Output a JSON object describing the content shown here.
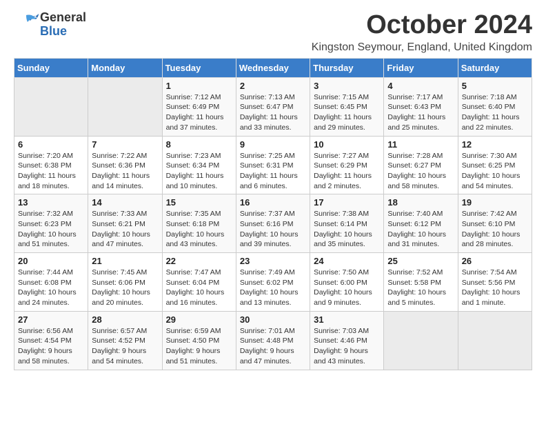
{
  "logo": {
    "general": "General",
    "blue": "Blue"
  },
  "title": "October 2024",
  "subtitle": "Kingston Seymour, England, United Kingdom",
  "days_of_week": [
    "Sunday",
    "Monday",
    "Tuesday",
    "Wednesday",
    "Thursday",
    "Friday",
    "Saturday"
  ],
  "weeks": [
    [
      {
        "day": "",
        "info": ""
      },
      {
        "day": "",
        "info": ""
      },
      {
        "day": "1",
        "info": "Sunrise: 7:12 AM\nSunset: 6:49 PM\nDaylight: 11 hours and 37 minutes."
      },
      {
        "day": "2",
        "info": "Sunrise: 7:13 AM\nSunset: 6:47 PM\nDaylight: 11 hours and 33 minutes."
      },
      {
        "day": "3",
        "info": "Sunrise: 7:15 AM\nSunset: 6:45 PM\nDaylight: 11 hours and 29 minutes."
      },
      {
        "day": "4",
        "info": "Sunrise: 7:17 AM\nSunset: 6:43 PM\nDaylight: 11 hours and 25 minutes."
      },
      {
        "day": "5",
        "info": "Sunrise: 7:18 AM\nSunset: 6:40 PM\nDaylight: 11 hours and 22 minutes."
      }
    ],
    [
      {
        "day": "6",
        "info": "Sunrise: 7:20 AM\nSunset: 6:38 PM\nDaylight: 11 hours and 18 minutes."
      },
      {
        "day": "7",
        "info": "Sunrise: 7:22 AM\nSunset: 6:36 PM\nDaylight: 11 hours and 14 minutes."
      },
      {
        "day": "8",
        "info": "Sunrise: 7:23 AM\nSunset: 6:34 PM\nDaylight: 11 hours and 10 minutes."
      },
      {
        "day": "9",
        "info": "Sunrise: 7:25 AM\nSunset: 6:31 PM\nDaylight: 11 hours and 6 minutes."
      },
      {
        "day": "10",
        "info": "Sunrise: 7:27 AM\nSunset: 6:29 PM\nDaylight: 11 hours and 2 minutes."
      },
      {
        "day": "11",
        "info": "Sunrise: 7:28 AM\nSunset: 6:27 PM\nDaylight: 10 hours and 58 minutes."
      },
      {
        "day": "12",
        "info": "Sunrise: 7:30 AM\nSunset: 6:25 PM\nDaylight: 10 hours and 54 minutes."
      }
    ],
    [
      {
        "day": "13",
        "info": "Sunrise: 7:32 AM\nSunset: 6:23 PM\nDaylight: 10 hours and 51 minutes."
      },
      {
        "day": "14",
        "info": "Sunrise: 7:33 AM\nSunset: 6:21 PM\nDaylight: 10 hours and 47 minutes."
      },
      {
        "day": "15",
        "info": "Sunrise: 7:35 AM\nSunset: 6:18 PM\nDaylight: 10 hours and 43 minutes."
      },
      {
        "day": "16",
        "info": "Sunrise: 7:37 AM\nSunset: 6:16 PM\nDaylight: 10 hours and 39 minutes."
      },
      {
        "day": "17",
        "info": "Sunrise: 7:38 AM\nSunset: 6:14 PM\nDaylight: 10 hours and 35 minutes."
      },
      {
        "day": "18",
        "info": "Sunrise: 7:40 AM\nSunset: 6:12 PM\nDaylight: 10 hours and 31 minutes."
      },
      {
        "day": "19",
        "info": "Sunrise: 7:42 AM\nSunset: 6:10 PM\nDaylight: 10 hours and 28 minutes."
      }
    ],
    [
      {
        "day": "20",
        "info": "Sunrise: 7:44 AM\nSunset: 6:08 PM\nDaylight: 10 hours and 24 minutes."
      },
      {
        "day": "21",
        "info": "Sunrise: 7:45 AM\nSunset: 6:06 PM\nDaylight: 10 hours and 20 minutes."
      },
      {
        "day": "22",
        "info": "Sunrise: 7:47 AM\nSunset: 6:04 PM\nDaylight: 10 hours and 16 minutes."
      },
      {
        "day": "23",
        "info": "Sunrise: 7:49 AM\nSunset: 6:02 PM\nDaylight: 10 hours and 13 minutes."
      },
      {
        "day": "24",
        "info": "Sunrise: 7:50 AM\nSunset: 6:00 PM\nDaylight: 10 hours and 9 minutes."
      },
      {
        "day": "25",
        "info": "Sunrise: 7:52 AM\nSunset: 5:58 PM\nDaylight: 10 hours and 5 minutes."
      },
      {
        "day": "26",
        "info": "Sunrise: 7:54 AM\nSunset: 5:56 PM\nDaylight: 10 hours and 1 minute."
      }
    ],
    [
      {
        "day": "27",
        "info": "Sunrise: 6:56 AM\nSunset: 4:54 PM\nDaylight: 9 hours and 58 minutes."
      },
      {
        "day": "28",
        "info": "Sunrise: 6:57 AM\nSunset: 4:52 PM\nDaylight: 9 hours and 54 minutes."
      },
      {
        "day": "29",
        "info": "Sunrise: 6:59 AM\nSunset: 4:50 PM\nDaylight: 9 hours and 51 minutes."
      },
      {
        "day": "30",
        "info": "Sunrise: 7:01 AM\nSunset: 4:48 PM\nDaylight: 9 hours and 47 minutes."
      },
      {
        "day": "31",
        "info": "Sunrise: 7:03 AM\nSunset: 4:46 PM\nDaylight: 9 hours and 43 minutes."
      },
      {
        "day": "",
        "info": ""
      },
      {
        "day": "",
        "info": ""
      }
    ]
  ]
}
